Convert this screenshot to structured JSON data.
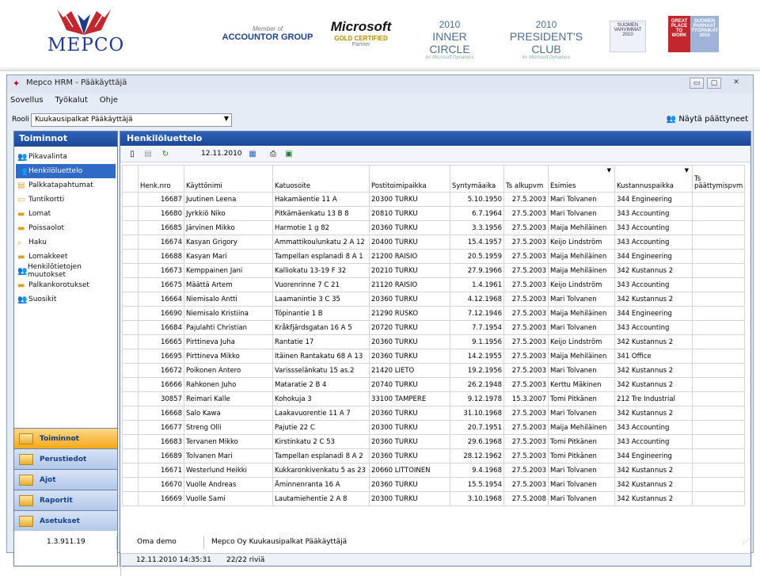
{
  "banner": {
    "logo_text": "MEPCO",
    "p1_a": "Member of",
    "p1_b": "ACCOUNTOR GROUP",
    "p2_a": "Microsoft",
    "p2_b": "GOLD CERTIFIED",
    "p2_c": "Partner",
    "p3_a": "2010",
    "p3_b": "INNER CIRCLE",
    "p3_c": "for Microsoft Dynamics",
    "p4_a": "2010",
    "p4_b": "PRESIDENT'S CLUB",
    "p4_c": "for Microsoft Dynamics",
    "p5": "SUOMEN VAHVIMMAT 2010",
    "p6_a": "GREAT PLACE TO WORK",
    "p6_b": "SUOMEN PARHAAT TYÖPAIKAT 2010"
  },
  "window": {
    "title": "Mepco HRM - Pääkäyttäjä",
    "min": "▭",
    "max": "▢",
    "close": "✕"
  },
  "menu": [
    "Sovellus",
    "Työkalut",
    "Ohje"
  ],
  "role": {
    "label": "Rooli",
    "value": "Kuukausipalkat Pääkäyttäjä",
    "arrow": "▼",
    "show_ended": "Näytä päättyneet"
  },
  "nav": {
    "header": "Toiminnot",
    "items": [
      "Pikavalinta",
      "Henkilöluettelo",
      "Palkkatapahtumat",
      "Tuntikortti",
      "Lomat",
      "Poissaolot",
      "Haku",
      "Lomakkeet",
      "Henkilötietojen muutokset",
      "Palkankorotukset",
      "Suosikit"
    ],
    "selected_index": 1,
    "panels": [
      "Toiminnot",
      "Perustiedot",
      "Ajot",
      "Raportit",
      "Asetukset"
    ]
  },
  "main": {
    "header": "Henkilöluettelo",
    "date": "12.11.2010"
  },
  "table": {
    "headers": [
      "Henk.nro",
      "Käyttönimi",
      "Katuosoite",
      "Postitoimipaikka",
      "Syntymäaika",
      "Ts alkupvm",
      "Esimies",
      "Kustannuspaikka",
      "Ts päättymispvm"
    ],
    "rows": [
      [
        "16687",
        "Juutinen Leena",
        "Hakamäentie 11 A",
        "20300  TURKU",
        "5.10.1950",
        "27.5.2003",
        "Mari Tolvanen",
        "344 Engineering",
        ""
      ],
      [
        "16680",
        "Jyrkkiö Niko",
        "Pitkämäenkatu 13 B 8",
        "20810  TURKU",
        "6.7.1964",
        "27.5.2003",
        "Mari Tolvanen",
        "343 Accounting",
        ""
      ],
      [
        "16685",
        "Järvinen Mikko",
        "Harmotie 1 g 82",
        "20360  TURKU",
        "3.3.1956",
        "27.5.2003",
        "Maija Mehiläinen",
        "343 Accounting",
        ""
      ],
      [
        "16674",
        "Kasyan Grigory",
        "Ammattikoulunkatu 2 A 12",
        "20400  TURKU",
        "15.4.1957",
        "27.5.2003",
        "Keijo Lindström",
        "343 Accounting",
        ""
      ],
      [
        "16688",
        "Kasyan Mari",
        "Tampellan esplanadi 8 A 1",
        "21200  RAISIO",
        "20.5.1959",
        "27.5.2003",
        "Maija Mehiläinen",
        "344 Engineering",
        ""
      ],
      [
        "16673",
        "Kemppainen Jani",
        "Kalliokatu 13-19 F 32",
        "20210  TURKU",
        "27.9.1966",
        "27.5.2003",
        "Maija Mehiläinen",
        "342 Kustannus 2",
        ""
      ],
      [
        "16675",
        "Määttä Artem",
        "Vuorenrinne 7 C 21",
        "21120  RAISIO",
        "1.4.1961",
        "27.5.2003",
        "Keijo Lindström",
        "343 Accounting",
        ""
      ],
      [
        "16664",
        "Niemisalo Antti",
        "Laamanintie 3 C 35",
        "20360  TURKU",
        "4.12.1968",
        "27.5.2003",
        "Mari Tolvanen",
        "342 Kustannus 2",
        ""
      ],
      [
        "16690",
        "Niemisalo Kristiina",
        "Töpinantie 1 B",
        "21290  RUSKO",
        "7.12.1946",
        "27.5.2003",
        "Maija Mehiläinen",
        "344 Engineering",
        ""
      ],
      [
        "16684",
        "Pajulahti Christian",
        "Kråkfjärdsgatan 16 A 5",
        "20720  TURKU",
        "7.7.1954",
        "27.5.2003",
        "Mari Tolvanen",
        "343 Accounting",
        ""
      ],
      [
        "16665",
        "Pirttineva Juha",
        "Rantatie 17",
        "20360  TURKU",
        "9.1.1956",
        "27.5.2003",
        "Keijo Lindström",
        "342 Kustannus 2",
        ""
      ],
      [
        "16695",
        "Pirttineva Mikko",
        "Itäinen Rantakatu 68 A 13",
        "20360  TURKU",
        "14.2.1955",
        "27.5.2003",
        "Maija Mehiläinen",
        "341 Office",
        ""
      ],
      [
        "16672",
        "Poikonen Antero",
        "Varissselänkatu 15 as.2",
        "21420  LIETO",
        "19.2.1956",
        "27.5.2003",
        "Mari Tolvanen",
        "342 Kustannus 2",
        ""
      ],
      [
        "16666",
        "Rahkonen Juho",
        "Mataratie 2 B 4",
        "20740  TURKU",
        "26.2.1948",
        "27.5.2003",
        "Kerttu Mäkinen",
        "342 Kustannus 2",
        ""
      ],
      [
        "30857",
        "Reimari Kalle",
        "Kohokuja 3",
        "33100 TAMPERE",
        "9.12.1978",
        "15.3.2007",
        "Tomi Pitkänen",
        "212 Tre Industrial",
        ""
      ],
      [
        "16668",
        "Salo Kawa",
        "Laakavuorentie 11 A 7",
        "20360  TURKU",
        "31.10.1968",
        "27.5.2003",
        "Mari Tolvanen",
        "342 Kustannus 2",
        ""
      ],
      [
        "16677",
        "Streng Olli",
        "Pajutie 22 C",
        "20300  TURKU",
        "20.7.1951",
        "27.5.2003",
        "Maija Mehiläinen",
        "343 Accounting",
        ""
      ],
      [
        "16683",
        "Tervanen Mikko",
        "Kirstinkatu 2 C 53",
        "20360  TURKU",
        "29.6.1968",
        "27.5.2003",
        "Tomi Pitkänen",
        "343 Accounting",
        ""
      ],
      [
        "16689",
        "Tolvanen Mari",
        "Tampellan esplanadi 8 A 2",
        "20360  TURKU",
        "28.12.1962",
        "27.5.2003",
        "Tomi Pitkänen",
        "344 Engineering",
        ""
      ],
      [
        "16671",
        "Westerlund Heikki",
        "Kukkaronkivenkatu 5 as 23",
        "20660  LITTOINEN",
        "9.4.1968",
        "27.5.2003",
        "Mari Tolvanen",
        "342 Kustannus 2",
        ""
      ],
      [
        "16670",
        "Vuolle Andreas",
        "Äminnenranta 16 A",
        "20360  TURKU",
        "15.5.1954",
        "27.5.2003",
        "Mari Tolvanen",
        "342 Kustannus 2",
        ""
      ],
      [
        "16669",
        "Vuolle Sami",
        "Lautamiehentie 2 A 8",
        "20300  TURKU",
        "3.10.1968",
        "27.5.2008",
        "Mari Tolvanen",
        "342 Kustannus 2",
        ""
      ]
    ]
  },
  "grid_status": {
    "timestamp": "12.11.2010 14:35:31",
    "rows": "22/22 riviä"
  },
  "statusbar": {
    "version": "1.3.911.19",
    "db": "Oma demo",
    "company": "Mepco Oy  Kuukausipalkat  Pääkäyttäjä"
  }
}
